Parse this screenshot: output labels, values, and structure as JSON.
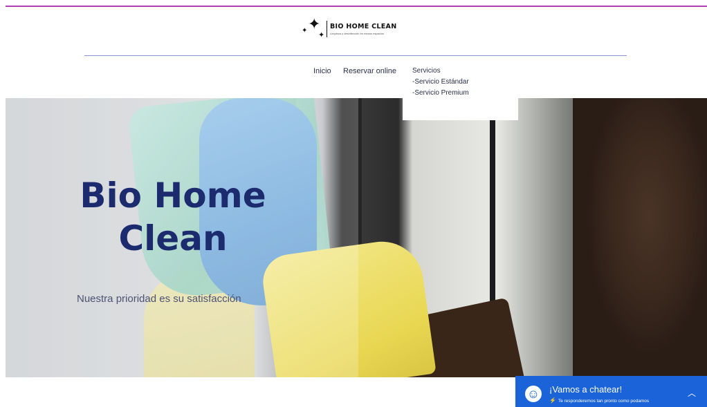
{
  "brand": {
    "name": "BIO HOME CLEAN",
    "tagline": "Limpieza y desinfección en menos espacios"
  },
  "nav": {
    "items": [
      "Inicio",
      "Reservar online",
      "Servicios"
    ],
    "submenu": [
      "-Servicio Estándar",
      "-Servicio Premium"
    ]
  },
  "hero": {
    "title": "Bio Home Clean",
    "subtitle": "Nuestra prioridad es su satisfacción"
  },
  "chat": {
    "title": "¡Vamos a chatear!",
    "subtitle": "Te responderemos tan pronto como podamos"
  },
  "colors": {
    "accent_border": "#b13fb4",
    "title_navy": "#1c2a6e",
    "chat_blue": "#1a63d8"
  }
}
